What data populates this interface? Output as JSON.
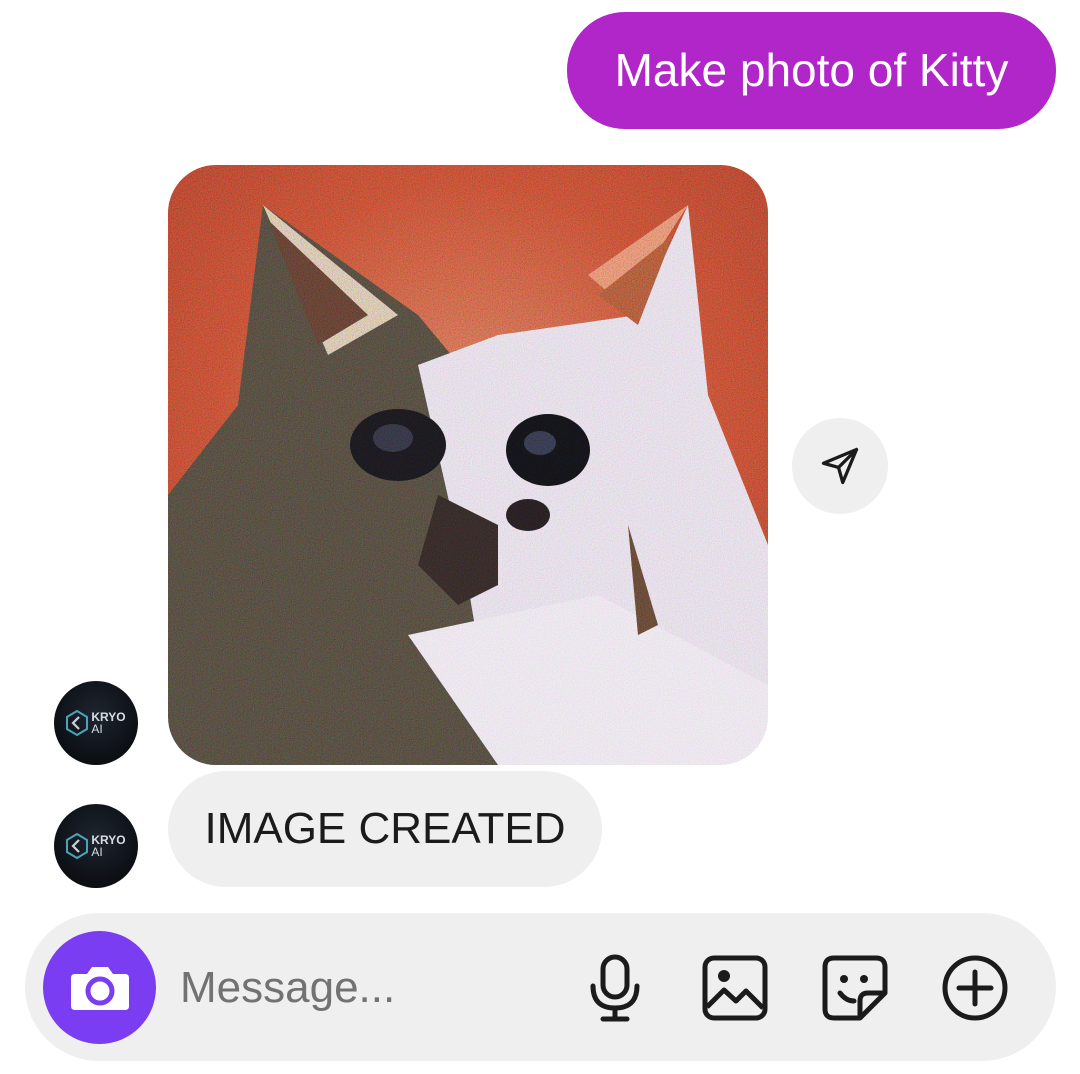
{
  "messages": {
    "outgoing_text": "Make photo of Kitty",
    "incoming_text": "IMAGE CREATED"
  },
  "generated_image": {
    "alt": "Make photo of Kitty",
    "icon": "generated-cat-image"
  },
  "avatar": {
    "brand_line1": "KRYO",
    "brand_line2": "AI"
  },
  "composer": {
    "placeholder": "Message..."
  },
  "icons": {
    "share": "send-icon",
    "camera": "camera-icon",
    "mic": "microphone-icon",
    "gallery": "image-icon",
    "sticker": "sticker-icon",
    "more": "plus-circle-icon"
  },
  "colors": {
    "outgoing_bubble": "#b026c9",
    "incoming_bubble": "#efefef",
    "camera_button": "#7b3df2",
    "avatar_bg": "#0c0f14",
    "icon_stroke": "#1b1b1b"
  }
}
